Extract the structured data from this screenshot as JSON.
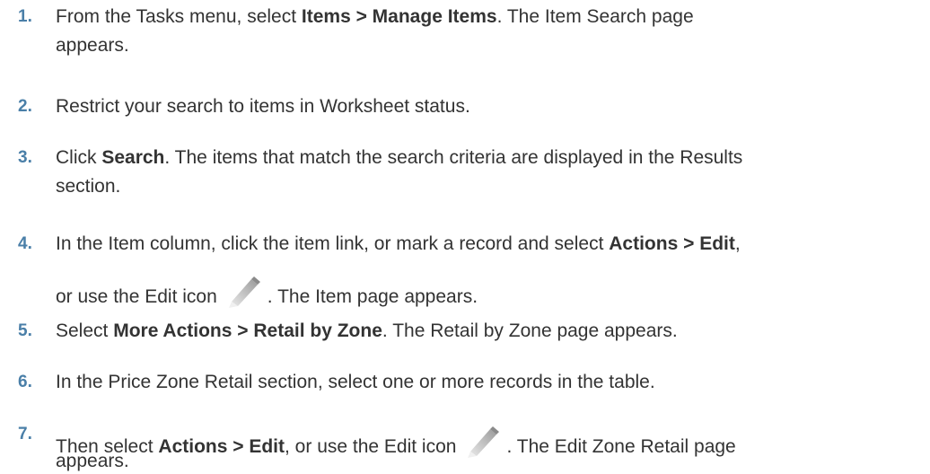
{
  "steps": [
    {
      "number": "1.",
      "lines": [
        [
          {
            "text": "From the Tasks menu, select ",
            "bold": false
          },
          {
            "text": "Items > Manage Items",
            "bold": true
          },
          {
            "text": ". The Item Search page",
            "bold": false
          }
        ],
        [
          {
            "text": "appears.",
            "bold": false
          }
        ]
      ]
    },
    {
      "number": "2.",
      "lines": [
        [
          {
            "text": "Restrict your search to items in Worksheet status.",
            "bold": false
          }
        ]
      ]
    },
    {
      "number": "3.",
      "lines": [
        [
          {
            "text": "Click ",
            "bold": false
          },
          {
            "text": "Search",
            "bold": true
          },
          {
            "text": ". The items that match the search criteria are displayed in the Results",
            "bold": false
          }
        ],
        [
          {
            "text": "section.",
            "bold": false
          }
        ]
      ]
    },
    {
      "number": "4.",
      "lines": [
        [
          {
            "text": "In the Item column, click the item link, or mark a record and select ",
            "bold": false
          },
          {
            "text": "Actions > Edit",
            "bold": true
          },
          {
            "text": ",",
            "bold": false
          }
        ],
        [
          {
            "text": "or use the Edit icon",
            "bold": false
          },
          {
            "icon": "pencil-edit-icon"
          },
          {
            "text": ". The Item page appears.",
            "bold": false
          }
        ]
      ]
    },
    {
      "number": "5.",
      "lines": [
        [
          {
            "text": "Select ",
            "bold": false
          },
          {
            "text": "More Actions > Retail by Zone",
            "bold": true
          },
          {
            "text": ". The Retail by Zone page appears.",
            "bold": false
          }
        ]
      ]
    },
    {
      "number": "6.",
      "lines": [
        [
          {
            "text": "In the Price Zone Retail section, select one or more records in the table.",
            "bold": false
          }
        ]
      ]
    },
    {
      "number": "7.",
      "lines": [
        [
          {
            "text": "Then select ",
            "bold": false
          },
          {
            "text": "Actions > Edit",
            "bold": true
          },
          {
            "text": ", or use the Edit icon",
            "bold": false
          },
          {
            "icon": "pencil-edit-icon"
          },
          {
            "text": ". The Edit Zone Retail page",
            "bold": false
          }
        ],
        [
          {
            "text": "appears.",
            "bold": false
          }
        ]
      ]
    }
  ],
  "colors": {
    "number": "#4a7fa8",
    "text": "#333333"
  }
}
